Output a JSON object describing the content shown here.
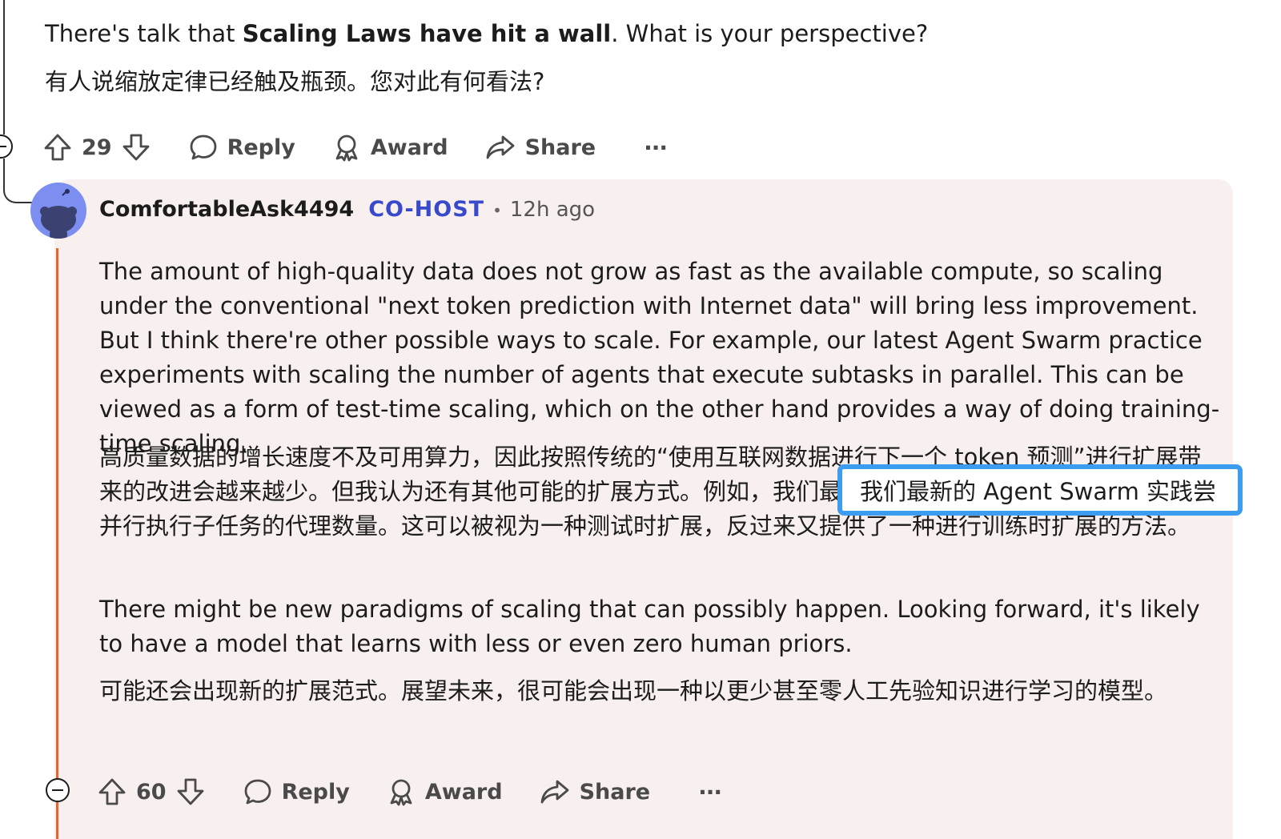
{
  "parent_comment": {
    "text_en_before": "There's talk that ",
    "text_en_bold": "Scaling Laws have hit a wall",
    "text_en_after": ". What is your perspective?",
    "text_zh": "有人说缩放定律已经触及瓶颈。您对此有何看法?",
    "votes": "29",
    "actions": {
      "reply": "Reply",
      "award": "Award",
      "share": "Share",
      "more": "···"
    }
  },
  "reply_comment": {
    "author": "ComfortableAsk4494",
    "flair": "CO-HOST",
    "separator": "•",
    "time": "12h ago",
    "paragraphs": [
      "The amount of high-quality data does not grow as fast as the available compute, so scaling under the conventional \"next token prediction with Internet data\" will bring less improvement. But I think there're other possible ways to scale. For example, our latest Agent Swarm practice experiments with scaling the number of agents that execute subtasks in parallel. This can be viewed as a form of test-time scaling, which on the other hand provides a way of doing training-time scaling.",
      "高质量数据的增长速度不及可用算力，因此按照传统的“使用互联网数据进行下一个 token 预测”进行扩展带来的改进会越来越少。但我认为还有其他可能的扩展方式。例如，我们最新的 Agent Swarm 实践尝试扩展并行执行子任务的代理数量。这可以被视为一种测试时扩展，反过来又提供了一种进行训练时扩展的方法。",
      "There might be new paradigms of scaling that can possibly happen. Looking forward, it's likely to have a model that learns with less or even zero human priors.",
      "可能还会出现新的扩展范式。展望未来，很可能会出现一种以更少甚至零人工先验知识进行学习的模型。"
    ],
    "highlight_text": "我们最新的 Agent Swarm 实践尝",
    "votes": "60",
    "actions": {
      "reply": "Reply",
      "award": "Award",
      "share": "Share",
      "more": "···"
    }
  },
  "colors": {
    "reply_background": "#f8f0ee",
    "thread_line": "#e8642d",
    "host_flair": "#3949cc",
    "highlight_border": "#3b9cf0",
    "avatar": "#7c8ff0"
  }
}
